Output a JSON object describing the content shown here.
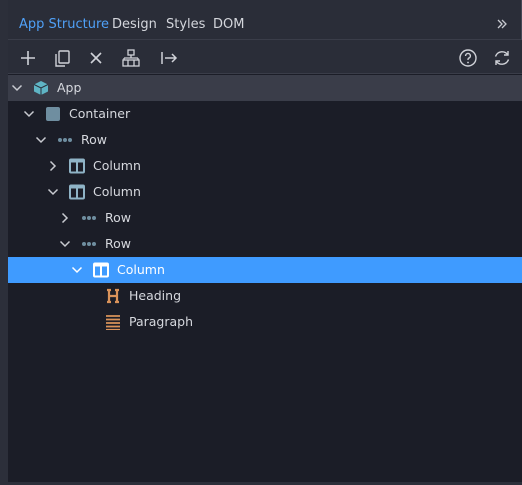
{
  "tabs": [
    {
      "label": "App Structure",
      "active": true
    },
    {
      "label": "Design",
      "active": false
    },
    {
      "label": "Styles",
      "active": false
    },
    {
      "label": "DOM",
      "active": false
    }
  ],
  "toolbar": {
    "icons": [
      "plus-icon",
      "copy-icon",
      "close-icon",
      "wrap-icon",
      "move-icon",
      "help-icon",
      "refresh-icon"
    ]
  },
  "tree": [
    {
      "label": "App",
      "icon": "cube-icon",
      "expanded": true
    },
    {
      "label": "Container",
      "icon": "square-icon",
      "expanded": true
    },
    {
      "label": "Row",
      "icon": "dots-icon",
      "expanded": true
    },
    {
      "label": "Column",
      "icon": "column-icon",
      "expanded": false
    },
    {
      "label": "Column",
      "icon": "column-icon",
      "expanded": true
    },
    {
      "label": "Row",
      "icon": "dots-icon",
      "expanded": false
    },
    {
      "label": "Row",
      "icon": "dots-icon",
      "expanded": true
    },
    {
      "label": "Column",
      "icon": "column-icon",
      "expanded": true,
      "selected": true
    },
    {
      "label": "Heading",
      "icon": "heading-icon"
    },
    {
      "label": "Paragraph",
      "icon": "paragraph-icon"
    }
  ],
  "colors": {
    "accent": "#3f9bff",
    "tab_active": "#4fa0f7",
    "icon_teal": "#5fb4c4",
    "icon_orange": "#d9925a"
  }
}
